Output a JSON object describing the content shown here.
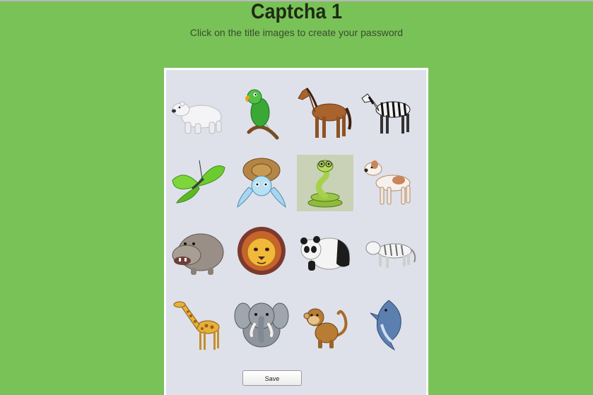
{
  "header": {
    "title": "Captcha 1",
    "subtitle": "Click on the title images to create your password"
  },
  "grid": {
    "tiles": [
      {
        "icon": "polar-bear-icon",
        "selected": false
      },
      {
        "icon": "parrot-icon",
        "selected": false
      },
      {
        "icon": "horse-icon",
        "selected": false
      },
      {
        "icon": "zebra-icon",
        "selected": false
      },
      {
        "icon": "butterfly-icon",
        "selected": false
      },
      {
        "icon": "turtle-icon",
        "selected": false
      },
      {
        "icon": "snake-icon",
        "selected": true
      },
      {
        "icon": "dog-icon",
        "selected": false
      },
      {
        "icon": "hippo-icon",
        "selected": false
      },
      {
        "icon": "lion-icon",
        "selected": false
      },
      {
        "icon": "panda-icon",
        "selected": false
      },
      {
        "icon": "tiger-icon",
        "selected": false
      },
      {
        "icon": "giraffe-icon",
        "selected": false
      },
      {
        "icon": "elephant-icon",
        "selected": false
      },
      {
        "icon": "monkey-icon",
        "selected": false
      },
      {
        "icon": "dolphin-icon",
        "selected": false
      }
    ]
  },
  "actions": {
    "save_label": "Save"
  },
  "colors": {
    "background": "#79c257",
    "panel": "#dfe1ea",
    "selected_tile": "#c9d2b6"
  }
}
